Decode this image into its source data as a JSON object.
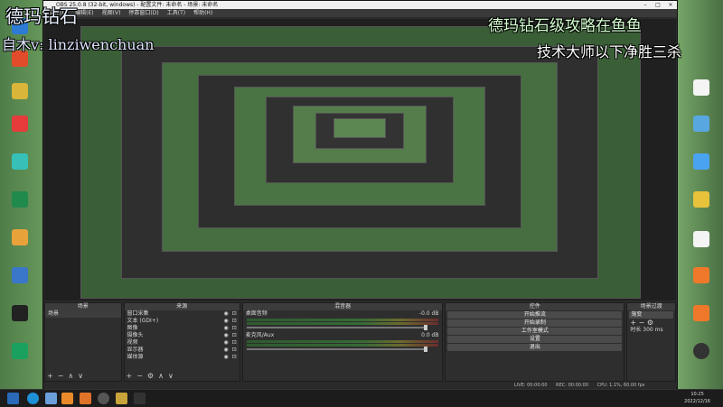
{
  "overlays": {
    "top_left": "德玛钻石",
    "top_left_2": "自木v: linziwenchuan",
    "top_right": "德玛钻石级攻略在鱼鱼",
    "top_right_2": "技术大师以下净胜三杀"
  },
  "window": {
    "title": "OBS 25.0.8 (32-bit, windows) - 配置文件: 未命名 - 场景: 未命名",
    "menu": [
      "文件(F)",
      "编辑(E)",
      "视图(V)",
      "停靠窗口(D)",
      "工具(T)",
      "帮助(H)"
    ]
  },
  "docks": {
    "scenes": {
      "title": "场景",
      "items": [
        "场景"
      ]
    },
    "sources": {
      "title": "来源",
      "items": [
        "窗口采集",
        "文本 (GDI+)",
        "图像",
        "摄像头",
        "视频",
        "显示器",
        "媒体源"
      ]
    },
    "mixer": {
      "title": "混音器",
      "channels": [
        {
          "name": "桌面音频",
          "db": "-0.0 dB"
        },
        {
          "name": "麦克风/Aux",
          "db": "0.0 dB"
        }
      ]
    },
    "controls": {
      "title": "控件",
      "buttons": [
        "开始推流",
        "开始录制",
        "工作室模式",
        "设置",
        "退出"
      ]
    },
    "transitions": {
      "title": "场景过渡",
      "selected": "渐变",
      "duration_label": "时长",
      "duration": "300 ms"
    }
  },
  "status": {
    "live": "LIVE: 00:00:00",
    "rec": "REC: 00:00:00",
    "cpu": "CPU: 1.1%, 60.00 fps"
  },
  "taskbar": {
    "time": "10:25",
    "date": "2022/12/16"
  },
  "colors": {
    "accent": "#3c9d3c",
    "window_bg": "#2b2b2b"
  }
}
